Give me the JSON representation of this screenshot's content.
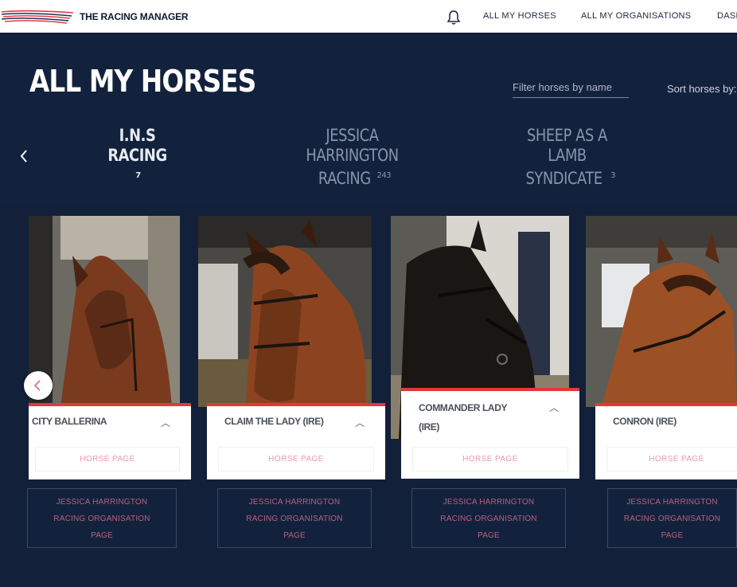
{
  "navbar": {
    "brand": "THE RACING MANAGER",
    "links": [
      "ALL MY HORSES",
      "ALL MY ORGANISATIONS",
      "DASH"
    ]
  },
  "header": {
    "title": "ALL MY HORSES",
    "filter_placeholder": "Filter horses by name",
    "sort_label": "Sort horses by:"
  },
  "organisations": [
    {
      "name": "I.N.S RACING",
      "count": "7"
    },
    {
      "name": "JESSICA HARRINGTON RACING",
      "line1": "JESSICA HARRINGTON",
      "line2": "RACING",
      "count": "243"
    },
    {
      "name": "SHEEP AS A LAMB SYNDICATE",
      "line1": "SHEEP AS A LAMB",
      "line2": "SYNDICATE",
      "count": "3"
    }
  ],
  "horses": [
    {
      "name": "CITY BALLERINA",
      "horse_page": "HORSE PAGE",
      "org_page_1": "JESSICA HARRINGTON",
      "org_page_2": "RACING ORGANISATION",
      "org_page_3": "PAGE"
    },
    {
      "name": "CLAIM THE LADY (IRE)",
      "horse_page": "HORSE PAGE",
      "org_page_1": "JESSICA HARRINGTON",
      "org_page_2": "RACING ORGANISATION",
      "org_page_3": "PAGE"
    },
    {
      "name_line1": "COMMANDER LADY",
      "name_line2": "(IRE)",
      "horse_page": "HORSE PAGE",
      "org_page_1": "JESSICA HARRINGTON",
      "org_page_2": "RACING ORGANISATION",
      "org_page_3": "PAGE"
    },
    {
      "name": "CONRON (IRE)",
      "horse_page": "HORSE PAGE",
      "org_page_1": "JESSICA HARRINGTON",
      "org_page_2": "RACING ORGANISATION",
      "org_page_3": "PAGE"
    }
  ],
  "colors": {
    "navy": "#13223c",
    "accent_red": "#e03a38",
    "pink_text": "#b9607e"
  }
}
